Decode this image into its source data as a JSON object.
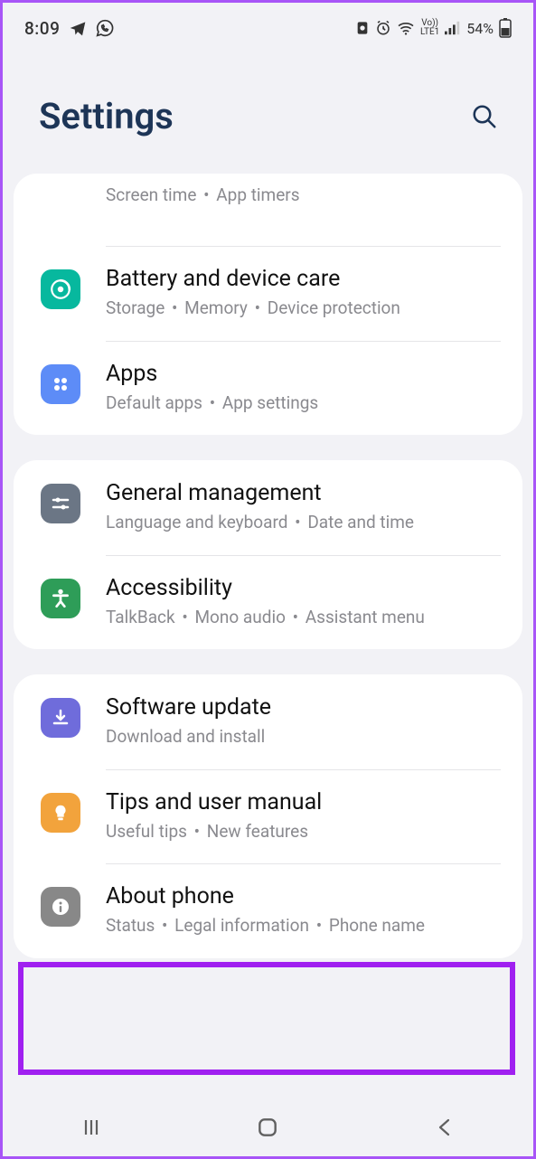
{
  "status": {
    "time": "8:09",
    "lte": "LTE1",
    "vo": "Vo))",
    "battery": "54%"
  },
  "header": {
    "title": "Settings"
  },
  "groups": [
    {
      "items": [
        {
          "id": "screentime",
          "partial": true,
          "sub": [
            "Screen time",
            "App timers"
          ]
        },
        {
          "id": "battery",
          "title": "Battery and device care",
          "sub": [
            "Storage",
            "Memory",
            "Device protection"
          ],
          "iconClass": "bg-teal",
          "iconName": "battery-care-icon"
        },
        {
          "id": "apps",
          "title": "Apps",
          "sub": [
            "Default apps",
            "App settings"
          ],
          "iconClass": "bg-blue",
          "iconName": "apps-icon"
        }
      ]
    },
    {
      "items": [
        {
          "id": "general",
          "title": "General management",
          "sub": [
            "Language and keyboard",
            "Date and time"
          ],
          "iconClass": "bg-slate",
          "iconName": "general-management-icon"
        },
        {
          "id": "accessibility",
          "title": "Accessibility",
          "sub": [
            "TalkBack",
            "Mono audio",
            "Assistant menu"
          ],
          "iconClass": "bg-green",
          "iconName": "accessibility-icon"
        }
      ]
    },
    {
      "items": [
        {
          "id": "software",
          "title": "Software update",
          "sub": [
            "Download and install"
          ],
          "iconClass": "bg-purple",
          "iconName": "software-update-icon"
        },
        {
          "id": "tips",
          "title": "Tips and user manual",
          "sub": [
            "Useful tips",
            "New features"
          ],
          "iconClass": "bg-orange",
          "iconName": "tips-icon"
        },
        {
          "id": "about",
          "title": "About phone",
          "sub": [
            "Status",
            "Legal information",
            "Phone name"
          ],
          "iconClass": "bg-grey",
          "iconName": "about-phone-icon"
        }
      ]
    }
  ]
}
